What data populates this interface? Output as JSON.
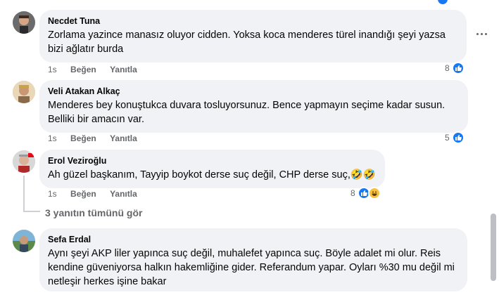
{
  "comments": [
    {
      "author": "Necdet Tuna",
      "text": "Zorlama yazince manasız oluyor cidden. Yoksa koca menderes türel inandığı şeyi yazsa bizi ağlatır burda",
      "time": "1s",
      "like_label": "Beğen",
      "reply_label": "Yanıtla",
      "reaction_count": "8",
      "reactions": [
        "like-icon"
      ]
    },
    {
      "author": "Veli Atakan Alkaç",
      "text": "Menderes bey konuştukca duvara tosluyorsunuz. Bence yapmayın seçime kadar susun. Belliki bir amacın var.",
      "time": "1s",
      "like_label": "Beğen",
      "reply_label": "Yanıtla",
      "reaction_count": "5",
      "reactions": [
        "like-icon"
      ]
    },
    {
      "author": "Erol Veziroğlu",
      "text": "Ah güzel başkanım, Tayyip boykot derse suç değil, CHP derse suç,🤣🤣",
      "time": "1s",
      "like_label": "Beğen",
      "reply_label": "Yanıtla",
      "reaction_count": "8",
      "reactions": [
        "like-icon",
        "haha-icon"
      ]
    },
    {
      "author": "Sefa Erdal",
      "text": "Aynı şeyi AKP liler yapınca suç değil, muhalefet yapınca suç. Böyle adalet mi olur. Reis kendine güveniyorsa halkın hakemliğine gider. Referandum yapar. Oyları %30 mu değil mi netleşir herkes işine bakar"
    }
  ],
  "view_replies_label": "3 yanıtın tümünü gör",
  "colors": {
    "bubble": "#f0f2f5",
    "meta_text": "#65676b",
    "like_blue": "#1877f2",
    "haha_yellow": "#f7c13e"
  }
}
